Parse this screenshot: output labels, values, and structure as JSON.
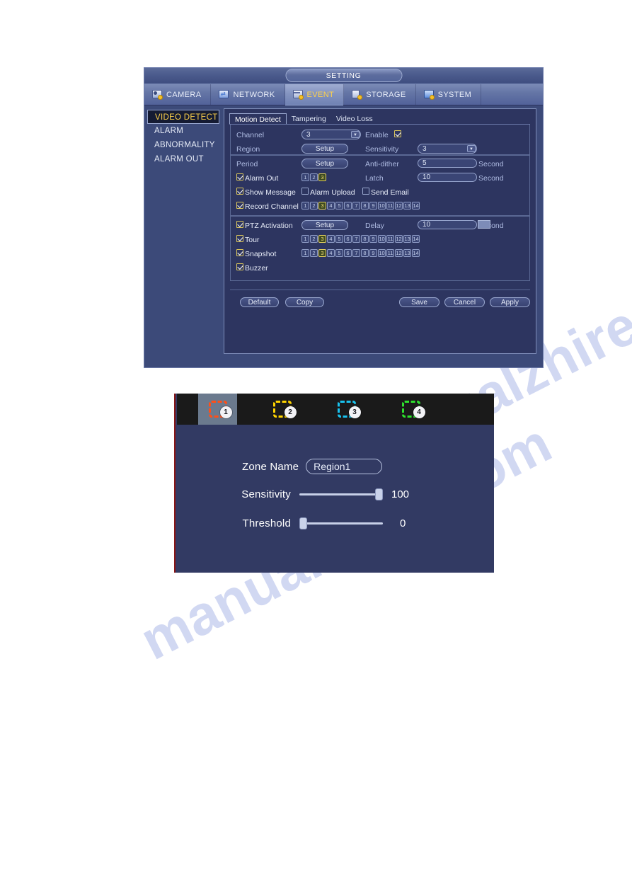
{
  "watermark": {
    "line1": "manualzhire.com",
    "line2": "manualzhire.com"
  },
  "setting_window": {
    "title": "SETTING",
    "main_tabs": [
      {
        "label": "CAMERA",
        "icon": "camera-icon",
        "active": false
      },
      {
        "label": "NETWORK",
        "icon": "network-icon",
        "active": false
      },
      {
        "label": "EVENT",
        "icon": "event-icon",
        "active": true
      },
      {
        "label": "STORAGE",
        "icon": "storage-icon",
        "active": false
      },
      {
        "label": "SYSTEM",
        "icon": "system-icon",
        "active": false
      }
    ],
    "sidebar": {
      "items": [
        {
          "label": "VIDEO DETECT",
          "active": true
        },
        {
          "label": "ALARM",
          "active": false
        },
        {
          "label": "ABNORMALITY",
          "active": false
        },
        {
          "label": "ALARM OUT",
          "active": false
        }
      ]
    },
    "sub_tabs": [
      {
        "label": "Motion Detect",
        "active": true
      },
      {
        "label": "Tampering",
        "active": false
      },
      {
        "label": "Video Loss",
        "active": false
      }
    ],
    "form": {
      "channel_label": "Channel",
      "channel_value": "3",
      "enable_label": "Enable",
      "enable_checked": true,
      "region_label": "Region",
      "region_button": "Setup",
      "sensitivity_label": "Sensitivity",
      "sensitivity_value": "3",
      "period_label": "Period",
      "period_button": "Setup",
      "antidither_label": "Anti-dither",
      "antidither_value": "5",
      "antidither_unit": "Second",
      "alarm_out_label": "Alarm Out",
      "alarm_out_checked": true,
      "alarm_out_channels": [
        "1",
        "2",
        "3"
      ],
      "alarm_out_selected": [
        "3"
      ],
      "latch_label": "Latch",
      "latch_value": "10",
      "latch_unit": "Second",
      "show_message_label": "Show Message",
      "show_message_checked": true,
      "alarm_upload_label": "Alarm Upload",
      "alarm_upload_checked": false,
      "send_email_label": "Send Email",
      "send_email_checked": false,
      "record_channel_label": "Record Channel",
      "record_channel_checked": true,
      "record_channels": [
        "1",
        "2",
        "3",
        "4",
        "5",
        "6",
        "7",
        "8",
        "9",
        "10",
        "11",
        "12",
        "13",
        "14"
      ],
      "record_selected": [
        "3"
      ],
      "ptz_label": "PTZ Activation",
      "ptz_checked": true,
      "ptz_button": "Setup",
      "delay_label": "Delay",
      "delay_value": "10",
      "delay_unit": "Second",
      "delay_unit_highlighted": "Sec",
      "tour_label": "Tour",
      "tour_checked": true,
      "tour_channels": [
        "1",
        "2",
        "3",
        "4",
        "5",
        "6",
        "7",
        "8",
        "9",
        "10",
        "11",
        "12",
        "13",
        "14"
      ],
      "tour_selected": [
        "3"
      ],
      "snapshot_label": "Snapshot",
      "snapshot_checked": true,
      "snapshot_channels": [
        "1",
        "2",
        "3",
        "4",
        "5",
        "6",
        "7",
        "8",
        "9",
        "10",
        "11",
        "12",
        "13",
        "14"
      ],
      "snapshot_selected": [
        "3"
      ],
      "buzzer_label": "Buzzer",
      "buzzer_checked": true
    },
    "footer_buttons": {
      "default": "Default",
      "copy": "Copy",
      "save": "Save",
      "cancel": "Cancel",
      "apply": "Apply"
    }
  },
  "zone_dialog": {
    "zones": [
      {
        "number": "1",
        "color": "#ff4f18",
        "active": true
      },
      {
        "number": "2",
        "color": "#ffd400",
        "active": false
      },
      {
        "number": "3",
        "color": "#19c3ef",
        "active": false
      },
      {
        "number": "4",
        "color": "#2ee02e",
        "active": false
      }
    ],
    "zone_name_label": "Zone Name",
    "zone_name_value": "Region1",
    "sensitivity_label": "Sensitivity",
    "sensitivity_value": "100",
    "sensitivity_percent": 100,
    "threshold_label": "Threshold",
    "threshold_value": "0",
    "threshold_percent": 0
  }
}
